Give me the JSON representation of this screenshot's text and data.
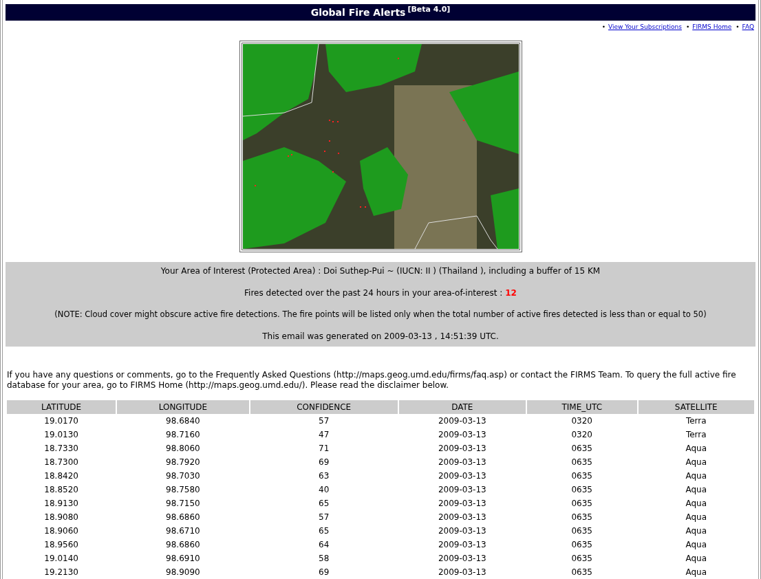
{
  "header": {
    "title": "Global Fire Alerts",
    "badge": "[Beta 4.0]"
  },
  "links": [
    {
      "bullet": "•",
      "label": "View Your Subscriptions"
    },
    {
      "bullet": "•",
      "label": "FIRMS Home"
    },
    {
      "bullet": "•",
      "label": "FAQ"
    }
  ],
  "summary": {
    "area": "Your Area of Interest (Protected Area) : Doi Suthep-Pui ~ (IUCN: II ) (Thailand ), including a buffer of 15 KM",
    "fires_label": "Fires detected over the past 24 hours in your area-of-interest :",
    "fire_count": "12",
    "note": "(NOTE: Cloud cover might obscure active fire detections. The fire points will be listed only when the total number of active fires detected is less than or equal to 50)",
    "generated": "This email was generated on 2009-03-13 , 14:51:39 UTC."
  },
  "info": "If you have any questions or comments, go to the Frequently Asked Questions (http://maps.geog.umd.edu/firms/faq.asp) or contact the FIRMS Team. To query the full active fire database for your area, go to FIRMS Home (http://maps.geog.umd.edu/). Please read the disclaimer below.",
  "table": {
    "columns": [
      "LATITUDE",
      "LONGITUDE",
      "CONFIDENCE",
      "DATE",
      "TIME_UTC",
      "SATELLITE"
    ],
    "rows": [
      [
        "19.0170",
        "98.6840",
        "57",
        "2009-03-13",
        "0320",
        "Terra"
      ],
      [
        "19.0130",
        "98.7160",
        "47",
        "2009-03-13",
        "0320",
        "Terra"
      ],
      [
        "18.7330",
        "98.8060",
        "71",
        "2009-03-13",
        "0635",
        "Aqua"
      ],
      [
        "18.7300",
        "98.7920",
        "69",
        "2009-03-13",
        "0635",
        "Aqua"
      ],
      [
        "18.8420",
        "98.7030",
        "63",
        "2009-03-13",
        "0635",
        "Aqua"
      ],
      [
        "18.8520",
        "98.7580",
        "40",
        "2009-03-13",
        "0635",
        "Aqua"
      ],
      [
        "18.9130",
        "98.7150",
        "65",
        "2009-03-13",
        "0635",
        "Aqua"
      ],
      [
        "18.9080",
        "98.6860",
        "57",
        "2009-03-13",
        "0635",
        "Aqua"
      ],
      [
        "18.9060",
        "98.6710",
        "65",
        "2009-03-13",
        "0635",
        "Aqua"
      ],
      [
        "18.9560",
        "98.6860",
        "64",
        "2009-03-13",
        "0635",
        "Aqua"
      ],
      [
        "19.0140",
        "98.6910",
        "58",
        "2009-03-13",
        "0635",
        "Aqua"
      ],
      [
        "19.2130",
        "98.9090",
        "69",
        "2009-03-13",
        "0635",
        "Aqua"
      ]
    ]
  }
}
